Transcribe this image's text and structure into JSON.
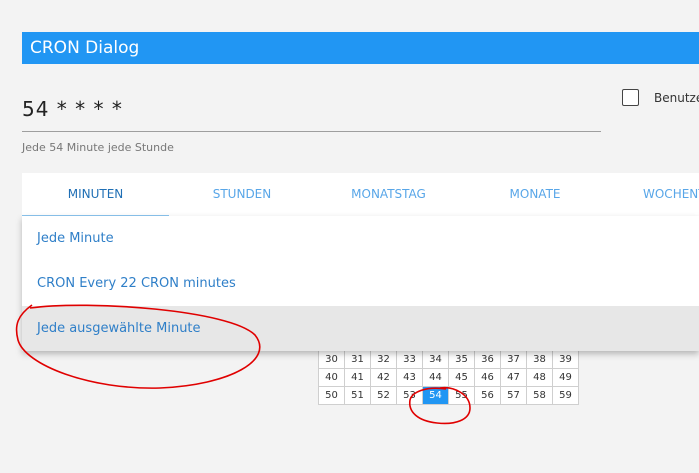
{
  "dialog": {
    "title": "CRON Dialog"
  },
  "expression": {
    "value": "54 * * * *",
    "description": "Jede 54 Minute jede Stunde"
  },
  "checkbox": {
    "label": "Benutze",
    "checked": false
  },
  "tabs": [
    {
      "label": "MINUTEN",
      "active": true
    },
    {
      "label": "STUNDEN",
      "active": false
    },
    {
      "label": "MONATSTAG",
      "active": false
    },
    {
      "label": "MONATE",
      "active": false
    },
    {
      "label": "WOCHENT",
      "active": false
    }
  ],
  "dropdown": {
    "options": [
      {
        "label": "Jede Minute"
      },
      {
        "label": "CRON Every 22 CRON minutes"
      },
      {
        "label": "Jede ausgewählte Minute",
        "highlighted": true
      }
    ]
  },
  "minute_grid": {
    "rows": [
      [
        "30",
        "31",
        "32",
        "33",
        "34",
        "35",
        "36",
        "37",
        "38",
        "39"
      ],
      [
        "40",
        "41",
        "42",
        "43",
        "44",
        "45",
        "46",
        "47",
        "48",
        "49"
      ],
      [
        "50",
        "51",
        "52",
        "53",
        "54",
        "55",
        "56",
        "57",
        "58",
        "59"
      ]
    ],
    "selected": "54"
  },
  "colors": {
    "titlebar": "#2196f3",
    "tab_text": "#58a6e8",
    "option_text": "#2f7fc8",
    "selected_cell": "#2196f3",
    "annotation": "#e00000"
  }
}
